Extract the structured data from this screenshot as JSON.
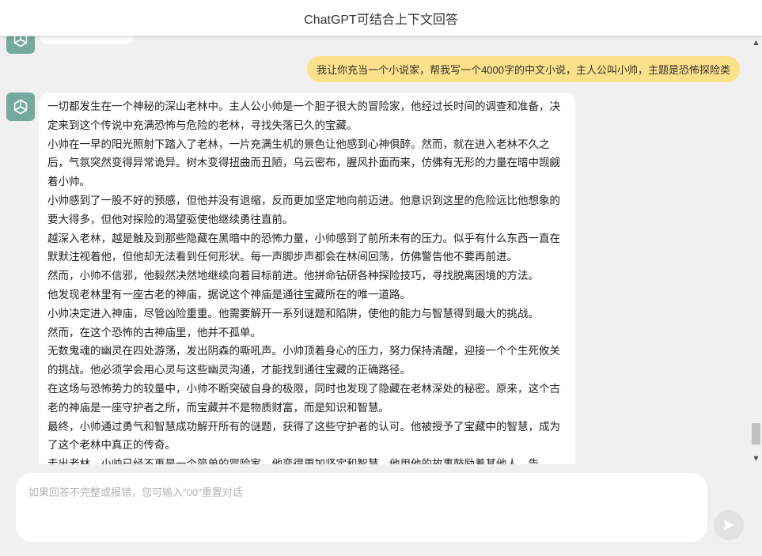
{
  "header": {
    "title": "ChatGPT可结合上下文回答"
  },
  "chat": {
    "user_message": "我让你充当一个小说家，帮我写一个4000字的中文小说，主人公叫小帅，主题是恐怖探险类",
    "assistant_icon": "openai-logo-icon",
    "assistant_paragraphs": [
      "一切都发生在一个神秘的深山老林中。主人公小帅是一个胆子很大的冒险家，他经过长时间的调查和准备，决定来到这个传说中充满恐怖与危险的老林，寻找失落已久的宝藏。",
      "小帅在一早的阳光照射下踏入了老林，一片充满生机的景色让他感到心神俱醉。然而，就在进入老林不久之后，气氛突然变得异常诡异。树木变得扭曲而丑陋，乌云密布，腥风扑面而来，仿佛有无形的力量在暗中觊觎着小帅。",
      "小帅感到了一股不好的预感，但他并没有退缩，反而更加坚定地向前迈进。他意识到这里的危险远比他想象的要大得多，但他对探险的渴望驱使他继续勇往直前。",
      "越深入老林，越是触及到那些隐藏在黑暗中的恐怖力量，小帅感到了前所未有的压力。似乎有什么东西一直在默默注视着他，但他却无法看到任何形状。每一声脚步声都会在林间回荡，仿佛警告他不要再前进。",
      "然而，小帅不信邪，他毅然决然地继续向着目标前进。他拼命钻研各种探险技巧，寻找脱离困境的方法。",
      "他发现老林里有一座古老的神庙，据说这个神庙是通往宝藏所在的唯一道路。",
      "小帅决定进入神庙，尽管凶险重重。他需要解开一系列谜题和陷阱，使他的能力与智慧得到最大的挑战。",
      "然而，在这个恐怖的古神庙里，他并不孤单。",
      "无数鬼魂的幽灵在四处游荡，发出阴森的嘶吼声。小帅顶着身心的压力，努力保持清醒，迎接一个个生死攸关的挑战。他必须学会用心灵与这些幽灵沟通，才能找到通往宝藏的正确路径。",
      "在这场与恐怖势力的较量中，小帅不断突破自身的极限，同时也发现了隐藏在老林深处的秘密。原来，这个古老的神庙是一座守护者之所，而宝藏并不是物质财富，而是知识和智慧。",
      "最终，小帅通过勇气和智慧成功解开所有的谜题，获得了这些守护者的认可。他被授予了宝藏中的智慧，成为了这个老林中真正的传奇。",
      "走出老林，小帅已经不再是一个简单的冒险家，他变得更加坚定和智慧。他用他的故事鼓励着其他人，告"
    ]
  },
  "input": {
    "placeholder": "如果回答不完整或报错，您可输入\"00\"重置对话",
    "value": ""
  },
  "icons": {
    "send": "send-icon",
    "scroll_up": "scroll-up-arrow-icon",
    "scroll_down": "scroll-down-arrow-icon"
  },
  "colors": {
    "user_bubble": "#fde18a",
    "assistant_avatar": "#74aa9c",
    "background": "#f0f0f0"
  }
}
